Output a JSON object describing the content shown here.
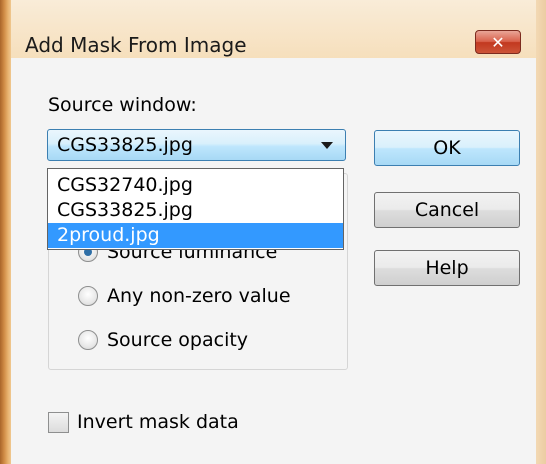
{
  "window": {
    "title": "Add Mask From Image",
    "close_glyph": "✕",
    "accent_close": "#c9452c",
    "frame_color": "#f6deb9"
  },
  "source": {
    "label": "Source window:",
    "selected": "CGS33825.jpg",
    "options": [
      "CGS32740.jpg",
      "CGS33825.jpg",
      "2proud.jpg"
    ],
    "highlighted_option": "2proud.jpg",
    "highlight_color": "#3399ff"
  },
  "create_mask_from": {
    "options": [
      {
        "label": "Source luminance",
        "checked": true
      },
      {
        "label": "Any non-zero value",
        "checked": false
      },
      {
        "label": "Source opacity",
        "checked": false
      }
    ]
  },
  "buttons": {
    "ok": "OK",
    "cancel": "Cancel",
    "help": "Help"
  },
  "invert": {
    "label": "Invert mask data",
    "checked": false
  },
  "icons": {
    "dropdown": "chevron-down-icon",
    "close": "close-icon"
  }
}
